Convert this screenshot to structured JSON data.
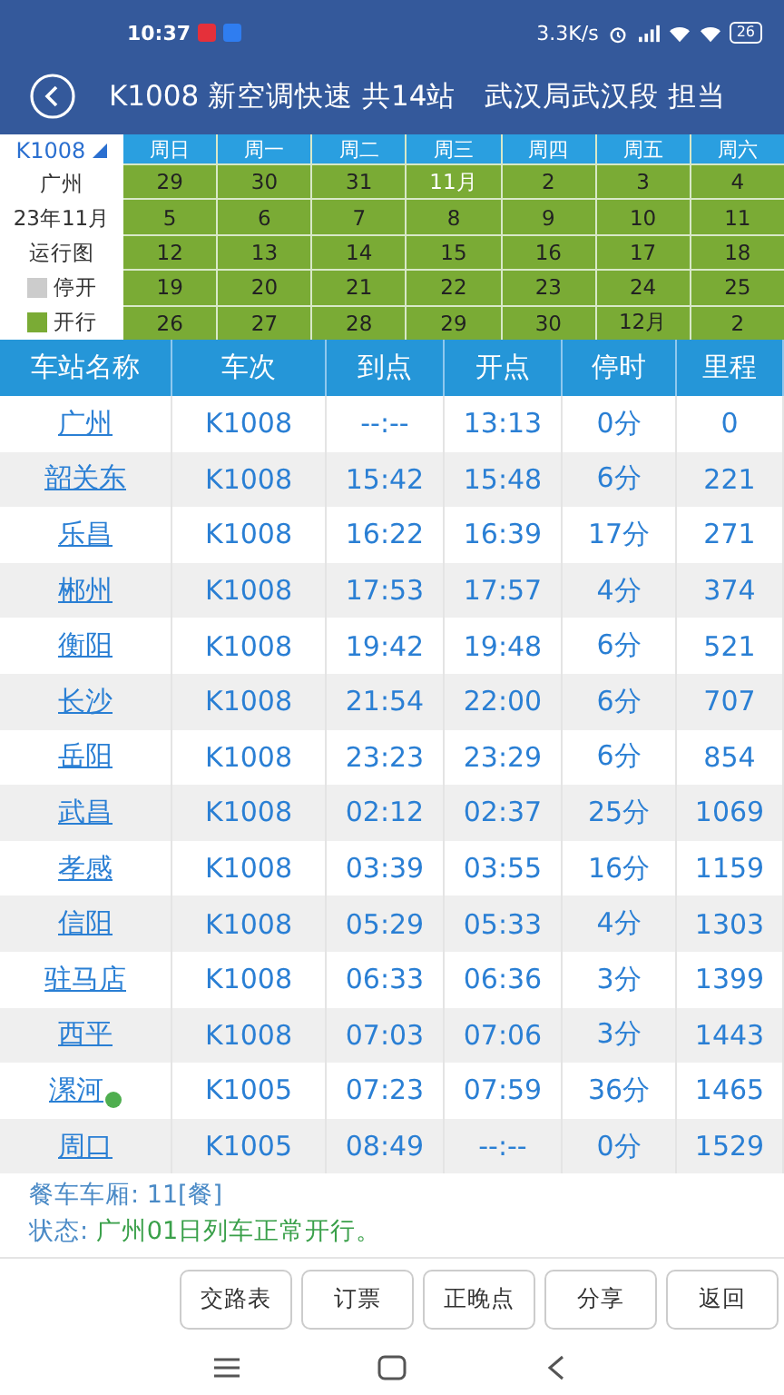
{
  "status_bar": {
    "time": "10:37",
    "speed": "3.3K/s",
    "battery": "26"
  },
  "title_bar": {
    "title": "K1008 新空调快速 共14站",
    "bureau": "武汉局武汉段 担当"
  },
  "calendar": {
    "train": "K1008",
    "station": "广州",
    "month": "23年11月",
    "caption": "运行图",
    "legend": [
      {
        "label": "停开",
        "color": "#cccccc"
      },
      {
        "label": "开行",
        "color": "#7aab35"
      }
    ],
    "weekdays": [
      "周日",
      "周一",
      "周二",
      "周三",
      "周四",
      "周五",
      "周六"
    ],
    "weeks": [
      [
        {
          "day": "29",
          "highlight": false
        },
        {
          "day": "30",
          "highlight": false
        },
        {
          "day": "31",
          "highlight": false
        },
        {
          "day": "11月",
          "highlight": true
        },
        {
          "day": "2",
          "highlight": false
        },
        {
          "day": "3",
          "highlight": false
        },
        {
          "day": "4",
          "highlight": false
        }
      ],
      [
        {
          "day": "5",
          "highlight": false
        },
        {
          "day": "6",
          "highlight": false
        },
        {
          "day": "7",
          "highlight": false
        },
        {
          "day": "8",
          "highlight": false
        },
        {
          "day": "9",
          "highlight": false
        },
        {
          "day": "10",
          "highlight": false
        },
        {
          "day": "11",
          "highlight": false
        }
      ],
      [
        {
          "day": "12",
          "highlight": false
        },
        {
          "day": "13",
          "highlight": false
        },
        {
          "day": "14",
          "highlight": false
        },
        {
          "day": "15",
          "highlight": false
        },
        {
          "day": "16",
          "highlight": false
        },
        {
          "day": "17",
          "highlight": false
        },
        {
          "day": "18",
          "highlight": false
        }
      ],
      [
        {
          "day": "19",
          "highlight": false
        },
        {
          "day": "20",
          "highlight": false
        },
        {
          "day": "21",
          "highlight": false
        },
        {
          "day": "22",
          "highlight": false
        },
        {
          "day": "23",
          "highlight": false
        },
        {
          "day": "24",
          "highlight": false
        },
        {
          "day": "25",
          "highlight": false
        }
      ],
      [
        {
          "day": "26",
          "highlight": false
        },
        {
          "day": "27",
          "highlight": false
        },
        {
          "day": "28",
          "highlight": false
        },
        {
          "day": "29",
          "highlight": false
        },
        {
          "day": "30",
          "highlight": false
        },
        {
          "day": "12月",
          "highlight": false
        },
        {
          "day": "2",
          "highlight": false
        }
      ]
    ]
  },
  "table": {
    "columns": [
      "车站名称",
      "车次",
      "到点",
      "开点",
      "停时",
      "里程"
    ],
    "rows": [
      {
        "station": "广州",
        "train": "K1008",
        "arrive": "--:--",
        "depart": "13:13",
        "stop": "0分",
        "km": "0",
        "badge": false
      },
      {
        "station": "韶关东",
        "train": "K1008",
        "arrive": "15:42",
        "depart": "15:48",
        "stop": "6分",
        "km": "221",
        "badge": false
      },
      {
        "station": "乐昌",
        "train": "K1008",
        "arrive": "16:22",
        "depart": "16:39",
        "stop": "17分",
        "km": "271",
        "badge": false
      },
      {
        "station": "郴州",
        "train": "K1008",
        "arrive": "17:53",
        "depart": "17:57",
        "stop": "4分",
        "km": "374",
        "badge": false
      },
      {
        "station": "衡阳",
        "train": "K1008",
        "arrive": "19:42",
        "depart": "19:48",
        "stop": "6分",
        "km": "521",
        "badge": false
      },
      {
        "station": "长沙",
        "train": "K1008",
        "arrive": "21:54",
        "depart": "22:00",
        "stop": "6分",
        "km": "707",
        "badge": false
      },
      {
        "station": "岳阳",
        "train": "K1008",
        "arrive": "23:23",
        "depart": "23:29",
        "stop": "6分",
        "km": "854",
        "badge": false
      },
      {
        "station": "武昌",
        "train": "K1008",
        "arrive": "02:12",
        "depart": "02:37",
        "stop": "25分",
        "km": "1069",
        "badge": false
      },
      {
        "station": "孝感",
        "train": "K1008",
        "arrive": "03:39",
        "depart": "03:55",
        "stop": "16分",
        "km": "1159",
        "badge": false
      },
      {
        "station": "信阳",
        "train": "K1008",
        "arrive": "05:29",
        "depart": "05:33",
        "stop": "4分",
        "km": "1303",
        "badge": false
      },
      {
        "station": "驻马店",
        "train": "K1008",
        "arrive": "06:33",
        "depart": "06:36",
        "stop": "3分",
        "km": "1399",
        "badge": false
      },
      {
        "station": "西平",
        "train": "K1008",
        "arrive": "07:03",
        "depart": "07:06",
        "stop": "3分",
        "km": "1443",
        "badge": false
      },
      {
        "station": "漯河",
        "train": "K1005",
        "arrive": "07:23",
        "depart": "07:59",
        "stop": "36分",
        "km": "1465",
        "badge": true
      },
      {
        "station": "周口",
        "train": "K1005",
        "arrive": "08:49",
        "depart": "--:--",
        "stop": "0分",
        "km": "1529",
        "badge": false
      }
    ]
  },
  "info": {
    "dining_label": "餐车车厢:",
    "dining_value": "11[餐]",
    "status_label": "状态:",
    "status_value": "广州01日列车正常开行。"
  },
  "buttons": [
    "交路表",
    "订票",
    "正晚点",
    "分享",
    "返回"
  ]
}
